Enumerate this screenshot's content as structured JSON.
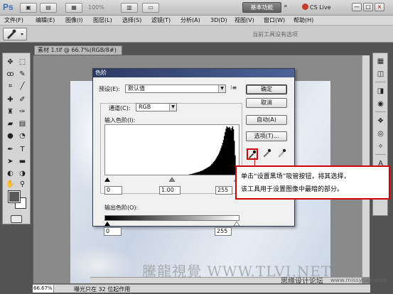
{
  "app": {
    "logo": "Ps",
    "zoom": "100%",
    "workspace": "基本功能",
    "workspace_chevron": "»",
    "cs_live": "CS Live",
    "window_controls": [
      "—",
      "□",
      "×"
    ]
  },
  "menu": [
    "文件(F)",
    "编辑(E)",
    "图像(I)",
    "图层(L)",
    "选择(S)",
    "滤镜(T)",
    "分析(A)",
    "3D(D)",
    "视图(V)",
    "窗口(W)",
    "帮助(H)"
  ],
  "options_bar": {
    "message": "当前工具没有选项"
  },
  "document": {
    "tab": "素材 1.tif @ 66.7%(RGB/8#)",
    "zoom": "66.67%",
    "status": "曝光只在 32 位起作用",
    "watermark": "騰龍視覺 WWW.TLVI.NET",
    "site_name": "思缘设计论坛",
    "site_url": "www.missyuan.com"
  },
  "levels_dialog": {
    "title": "色阶",
    "preset_label": "预设(E):",
    "preset_value": "默认值",
    "channel_label": "通道(C):",
    "channel_value": "RGB",
    "input_label": "输入色阶(I):",
    "input_black": "0",
    "input_gamma": "1.00",
    "input_white": "255",
    "output_label": "输出色阶(O):",
    "output_black": "0",
    "output_white": "255",
    "buttons": {
      "ok": "确定",
      "cancel": "取消",
      "auto": "自动(A)",
      "options": "选项(T)..."
    }
  },
  "histogram": {
    "heights": [
      0,
      0,
      0,
      0,
      0,
      0,
      0,
      0,
      0,
      0,
      0,
      0,
      0,
      0,
      0,
      0,
      0,
      0,
      0,
      0,
      0,
      0,
      0,
      0,
      0,
      0,
      0,
      0,
      0,
      0,
      0,
      0,
      0,
      0,
      0,
      0,
      0,
      0,
      0,
      0,
      0,
      0,
      0,
      0,
      0,
      0,
      0,
      0,
      0,
      0,
      0,
      0,
      0,
      0,
      0,
      0,
      0,
      0,
      0,
      0,
      0,
      0,
      0,
      0,
      0,
      0,
      0,
      0,
      0,
      0,
      0,
      0,
      0,
      0,
      0,
      0,
      0,
      0,
      0,
      0,
      0,
      0,
      0,
      0,
      0,
      0,
      0,
      0,
      0,
      0,
      0,
      0,
      0,
      0,
      0,
      0,
      0,
      0,
      0,
      0,
      0,
      0.01,
      0.01,
      0.01,
      0.02,
      0.02,
      0.03,
      0.03,
      0.04,
      0.04,
      0.05,
      0.05,
      0.06,
      0.06,
      0.07,
      0.08,
      0.08,
      0.09,
      0.1,
      0.11,
      0.12,
      0.13,
      0.14,
      0.15,
      0.16,
      0.17,
      0.18,
      0.2,
      0.22,
      0.24,
      0.26,
      0.28,
      0.3,
      0.33,
      0.36,
      0.39,
      0.42,
      0.46,
      0.5,
      0.55,
      0.6,
      0.66,
      0.72,
      0.8,
      0.88,
      0.95,
      1.0,
      0.98,
      0.97,
      0.99,
      0.96,
      0.92,
      0.97,
      1.0,
      0.94,
      0.7,
      0.4,
      0.1,
      0.02,
      0,
      0
    ]
  },
  "callout": {
    "line1": "单击“设置黑场”吸管按钮，将其选择，",
    "line2": "该工具用于设置图像中最暗的部分。"
  }
}
